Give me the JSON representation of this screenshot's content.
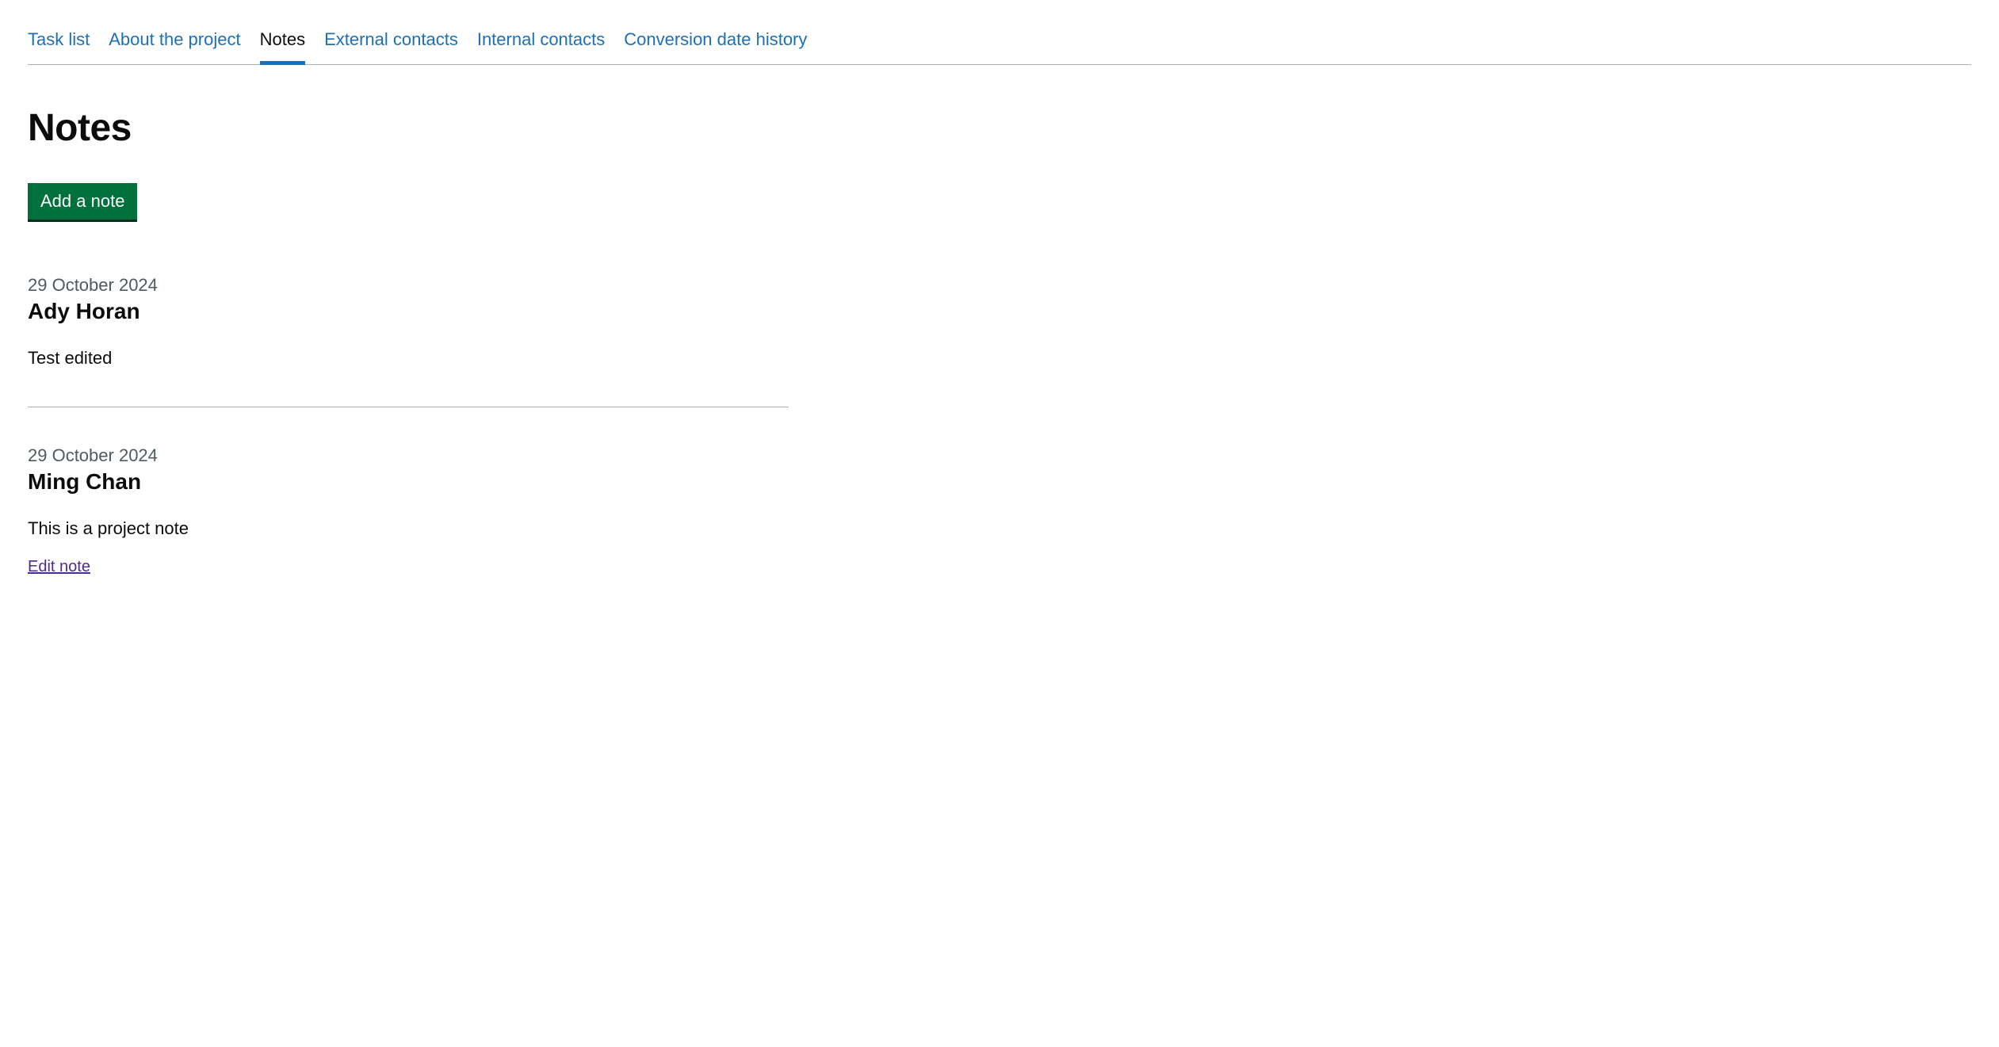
{
  "tabs": [
    {
      "label": "Task list",
      "active": false
    },
    {
      "label": "About the project",
      "active": false
    },
    {
      "label": "Notes",
      "active": true
    },
    {
      "label": "External contacts",
      "active": false
    },
    {
      "label": "Internal contacts",
      "active": false
    },
    {
      "label": "Conversion date history",
      "active": false
    }
  ],
  "page": {
    "title": "Notes",
    "add_button_label": "Add a note"
  },
  "notes": [
    {
      "date": "29 October 2024",
      "author": "Ady Horan",
      "body": "Test edited",
      "editable": false
    },
    {
      "date": "29 October 2024",
      "author": "Ming Chan",
      "body": "This is a project note",
      "editable": true,
      "edit_label": "Edit note"
    }
  ]
}
